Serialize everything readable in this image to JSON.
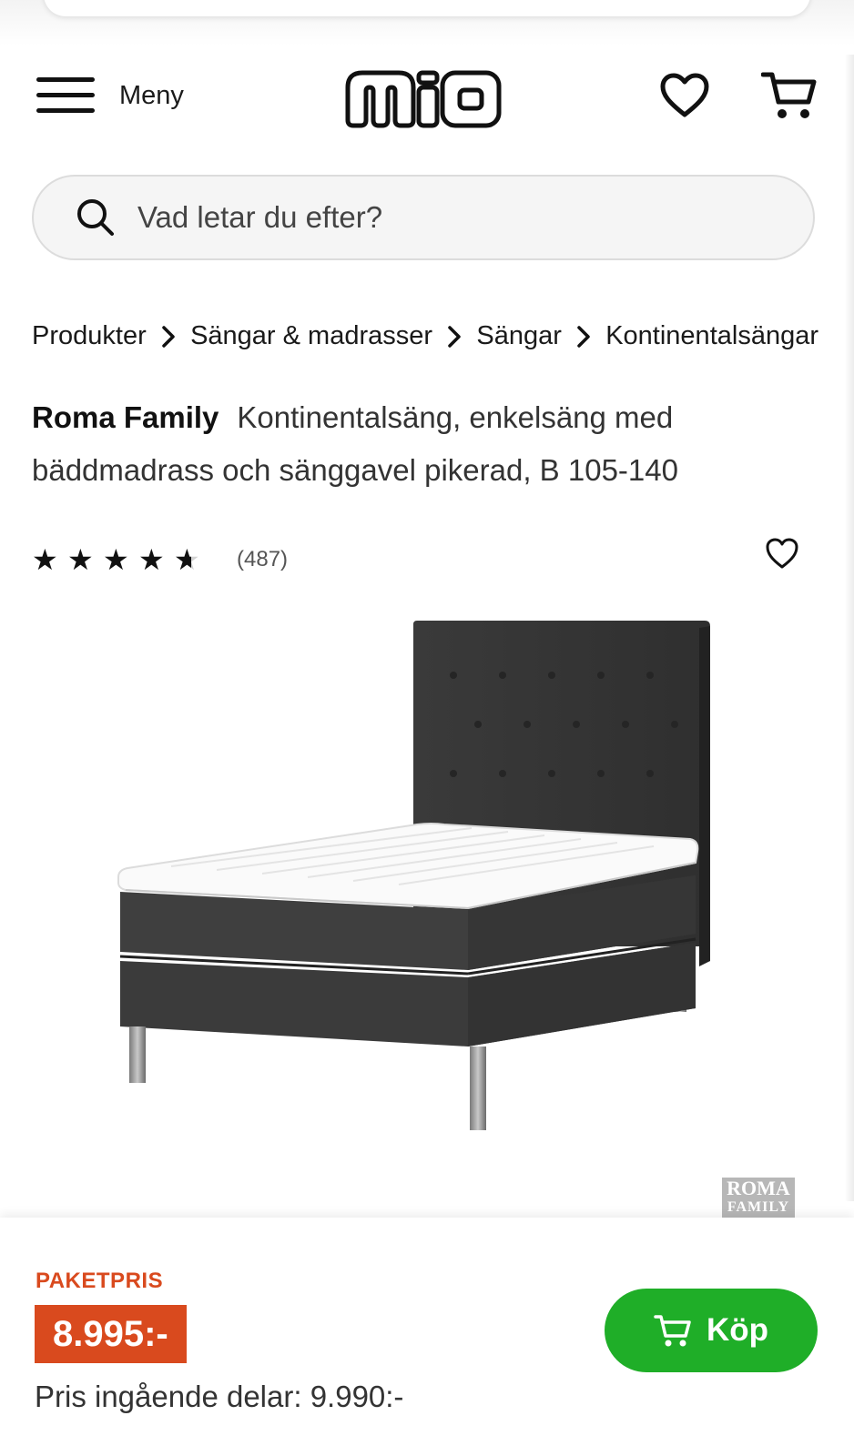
{
  "header": {
    "menu_label": "Meny",
    "logo_text": "mio"
  },
  "search": {
    "placeholder": "Vad letar du efter?"
  },
  "breadcrumb": [
    "Produkter",
    "Sängar & madrasser",
    "Sängar",
    "Kontinentalsängar"
  ],
  "product": {
    "brand": "Roma Family",
    "title": "Kontinentalsäng, enkelsäng med bäddmadrass och sänggavel pikerad, B 105-140",
    "rating": 4.5,
    "rating_max": 5,
    "review_count": "(487)",
    "watermark": [
      "ROMA",
      "FAMILY"
    ]
  },
  "bottom_bar": {
    "package_label": "PAKETPRIS",
    "price": "8.995:-",
    "parts_price": "Pris ingående delar: 9.990:-",
    "buy_label": "Köp"
  },
  "colors": {
    "accent_price": "#d94a1e",
    "buy_green": "#1fae28",
    "text": "#1a1a1a"
  },
  "icons": [
    "hamburger-icon",
    "heart-icon",
    "cart-icon",
    "search-icon",
    "chevron-right-icon",
    "star-icon"
  ]
}
